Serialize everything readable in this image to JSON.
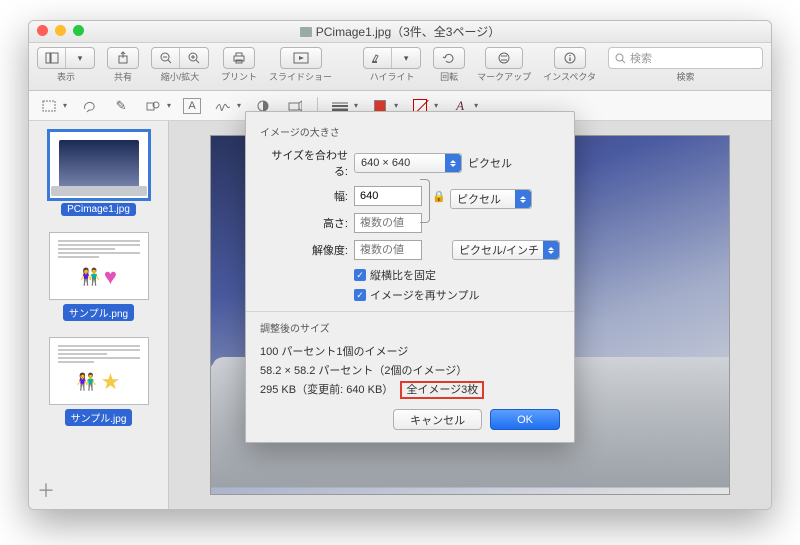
{
  "titlebar": {
    "title": "PCimage1.jpg（3件、全3ページ）"
  },
  "toolbar": {
    "view": "表示",
    "share": "共有",
    "zoom": "縮小/拡大",
    "print": "プリント",
    "slideshow": "スライドショー",
    "highlight": "ハイライト",
    "rotate": "回転",
    "markup": "マークアップ",
    "inspector": "インスペクタ",
    "search_label": "検索",
    "search_placeholder": "検索"
  },
  "sidebar": {
    "items": [
      {
        "filename": "PCimage1.jpg"
      },
      {
        "filename": "サンプル.png"
      },
      {
        "filename": "サンプル.jpg"
      }
    ],
    "add": "＋"
  },
  "dialog": {
    "section1_title": "イメージの大きさ",
    "fit_label": "サイズを合わせる:",
    "fit_value": "640 × 640",
    "fit_unit": "ピクセル",
    "width_label": "幅:",
    "width_value": "640",
    "height_label": "高さ:",
    "height_placeholder": "複数の値",
    "unit_sel": "ピクセル",
    "res_label": "解像度:",
    "res_placeholder": "複数の値",
    "res_unit": "ピクセル/インチ",
    "cb1": "縦横比を固定",
    "cb2": "イメージを再サンプル",
    "section2_title": "調整後のサイズ",
    "result1": "100 パーセント1個のイメージ",
    "result2": "58.2 × 58.2 パーセント（2個のイメージ）",
    "result3_a": "295 KB（変更前: 640 KB）",
    "result3_b": "全イメージ3枚",
    "cancel": "キャンセル",
    "ok": "OK"
  }
}
